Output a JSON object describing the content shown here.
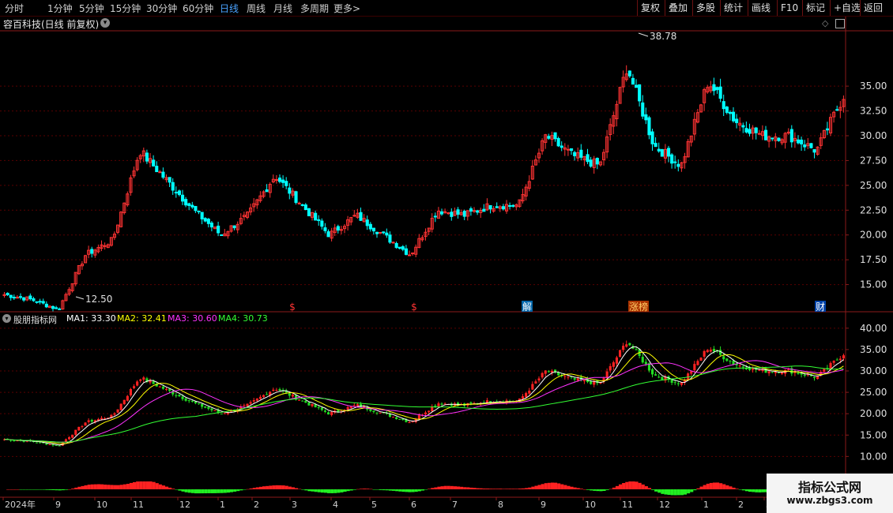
{
  "toolbar": {
    "periods": [
      "分时",
      "1分钟",
      "5分钟",
      "15分钟",
      "30分钟",
      "60分钟",
      "日线",
      "周线",
      "月线",
      "多周期",
      "更多"
    ],
    "active_period": "日线",
    "more_arrow": ">",
    "actions": [
      "复权",
      "叠加",
      "多股",
      "统计",
      "画线",
      "F10",
      "标记",
      "+自选",
      "返回"
    ]
  },
  "stock": {
    "title": "容百科技(日线 前复权)"
  },
  "main_chart": {
    "y_ticks": [
      "35.00",
      "32.50",
      "30.00",
      "27.50",
      "25.00",
      "22.50",
      "20.00",
      "17.50",
      "15.00"
    ],
    "y_values": [
      35,
      32.5,
      30,
      27.5,
      25,
      22.5,
      20,
      17.5,
      15
    ],
    "high_label": "38.78",
    "low_label": "12.50",
    "event_marks": [
      "$",
      "$",
      "解",
      "涨榜",
      "财"
    ]
  },
  "indicator": {
    "name": "股朋指标网",
    "ma": [
      {
        "label": "MA1: 33.30",
        "color": "#ffffff"
      },
      {
        "label": "MA2: 32.41",
        "color": "#ffff00"
      },
      {
        "label": "MA3: 30.60",
        "color": "#ff33ff"
      },
      {
        "label": "MA4: 30.73",
        "color": "#33ff33"
      }
    ],
    "y_ticks": [
      "40.00",
      "35.00",
      "30.00",
      "25.00",
      "20.00",
      "15.00",
      "10.00"
    ],
    "y_values": [
      40,
      35,
      30,
      25,
      20,
      15,
      10
    ]
  },
  "x_axis": {
    "labels": [
      "2024年",
      "9",
      "10",
      "11",
      "12",
      "1",
      "2",
      "3",
      "4",
      "5",
      "6",
      "7",
      "8",
      "9",
      "10",
      "11",
      "12",
      "1",
      "2",
      "3"
    ]
  },
  "watermark": {
    "title": "指标公式网",
    "url": "www.zbgs3.com"
  },
  "colors": {
    "up": "#ff3333",
    "down": "#00ffff",
    "grid": "#5a0000",
    "axis": "#8b1a1a"
  },
  "chart_data": {
    "type": "candlestick",
    "title": "容百科技(日线 前复权)",
    "period": "daily",
    "x_range": [
      "2024年8",
      "2025年3"
    ],
    "close_anchors": [
      {
        "x": "2024-08 start",
        "y": 14.0
      },
      {
        "x": "2024-09",
        "y": 13.5
      },
      {
        "x": "2024-09 end",
        "y": 12.5
      },
      {
        "x": "2024-10 early",
        "y": 18.0
      },
      {
        "x": "2024-10",
        "y": 19.5
      },
      {
        "x": "2024-11 early",
        "y": 28.5
      },
      {
        "x": "2024-11",
        "y": 25.5
      },
      {
        "x": "2024-12",
        "y": 22.5
      },
      {
        "x": "2025-01",
        "y": 20.0
      },
      {
        "x": "2025-02",
        "y": 22.0
      },
      {
        "x": "2025-03",
        "y": 26.0
      },
      {
        "x": "2025-03 end",
        "y": 23.0
      },
      {
        "x": "2025-04",
        "y": 20.0
      },
      {
        "x": "2025-04 mid",
        "y": 22.0
      },
      {
        "x": "2025-05",
        "y": 20.0
      },
      {
        "x": "2025-06",
        "y": 18.0
      },
      {
        "x": "2025-06 end",
        "y": 22.5
      },
      {
        "x": "2025-07",
        "y": 22.0
      },
      {
        "x": "2025-08",
        "y": 23.0
      },
      {
        "x": "2025-08 end",
        "y": 23.0
      },
      {
        "x": "2025-09",
        "y": 30.0
      },
      {
        "x": "2025-10",
        "y": 28.0
      },
      {
        "x": "2025-10 end",
        "y": 27.0
      },
      {
        "x": "2025-11 early",
        "y": 37.0
      },
      {
        "x": "2025-11",
        "y": 29.0
      },
      {
        "x": "2025-12",
        "y": 27.0
      },
      {
        "x": "2026-01",
        "y": 35.5
      },
      {
        "x": "2026-01 mid",
        "y": 31.5
      },
      {
        "x": "2026-02",
        "y": 30.0
      },
      {
        "x": "2026-03",
        "y": 30.0
      },
      {
        "x": "2026-03 mid",
        "y": 28.5
      },
      {
        "x": "2026-03 end",
        "y": 34.0
      }
    ],
    "high": 38.78,
    "low": 12.5,
    "ylim": [
      12.5,
      40.5
    ],
    "indicator_ylim": [
      6,
      42
    ],
    "indicator_ma_last": {
      "MA1": 33.3,
      "MA2": 32.41,
      "MA3": 30.6,
      "MA4": 30.73
    },
    "grid": true
  }
}
